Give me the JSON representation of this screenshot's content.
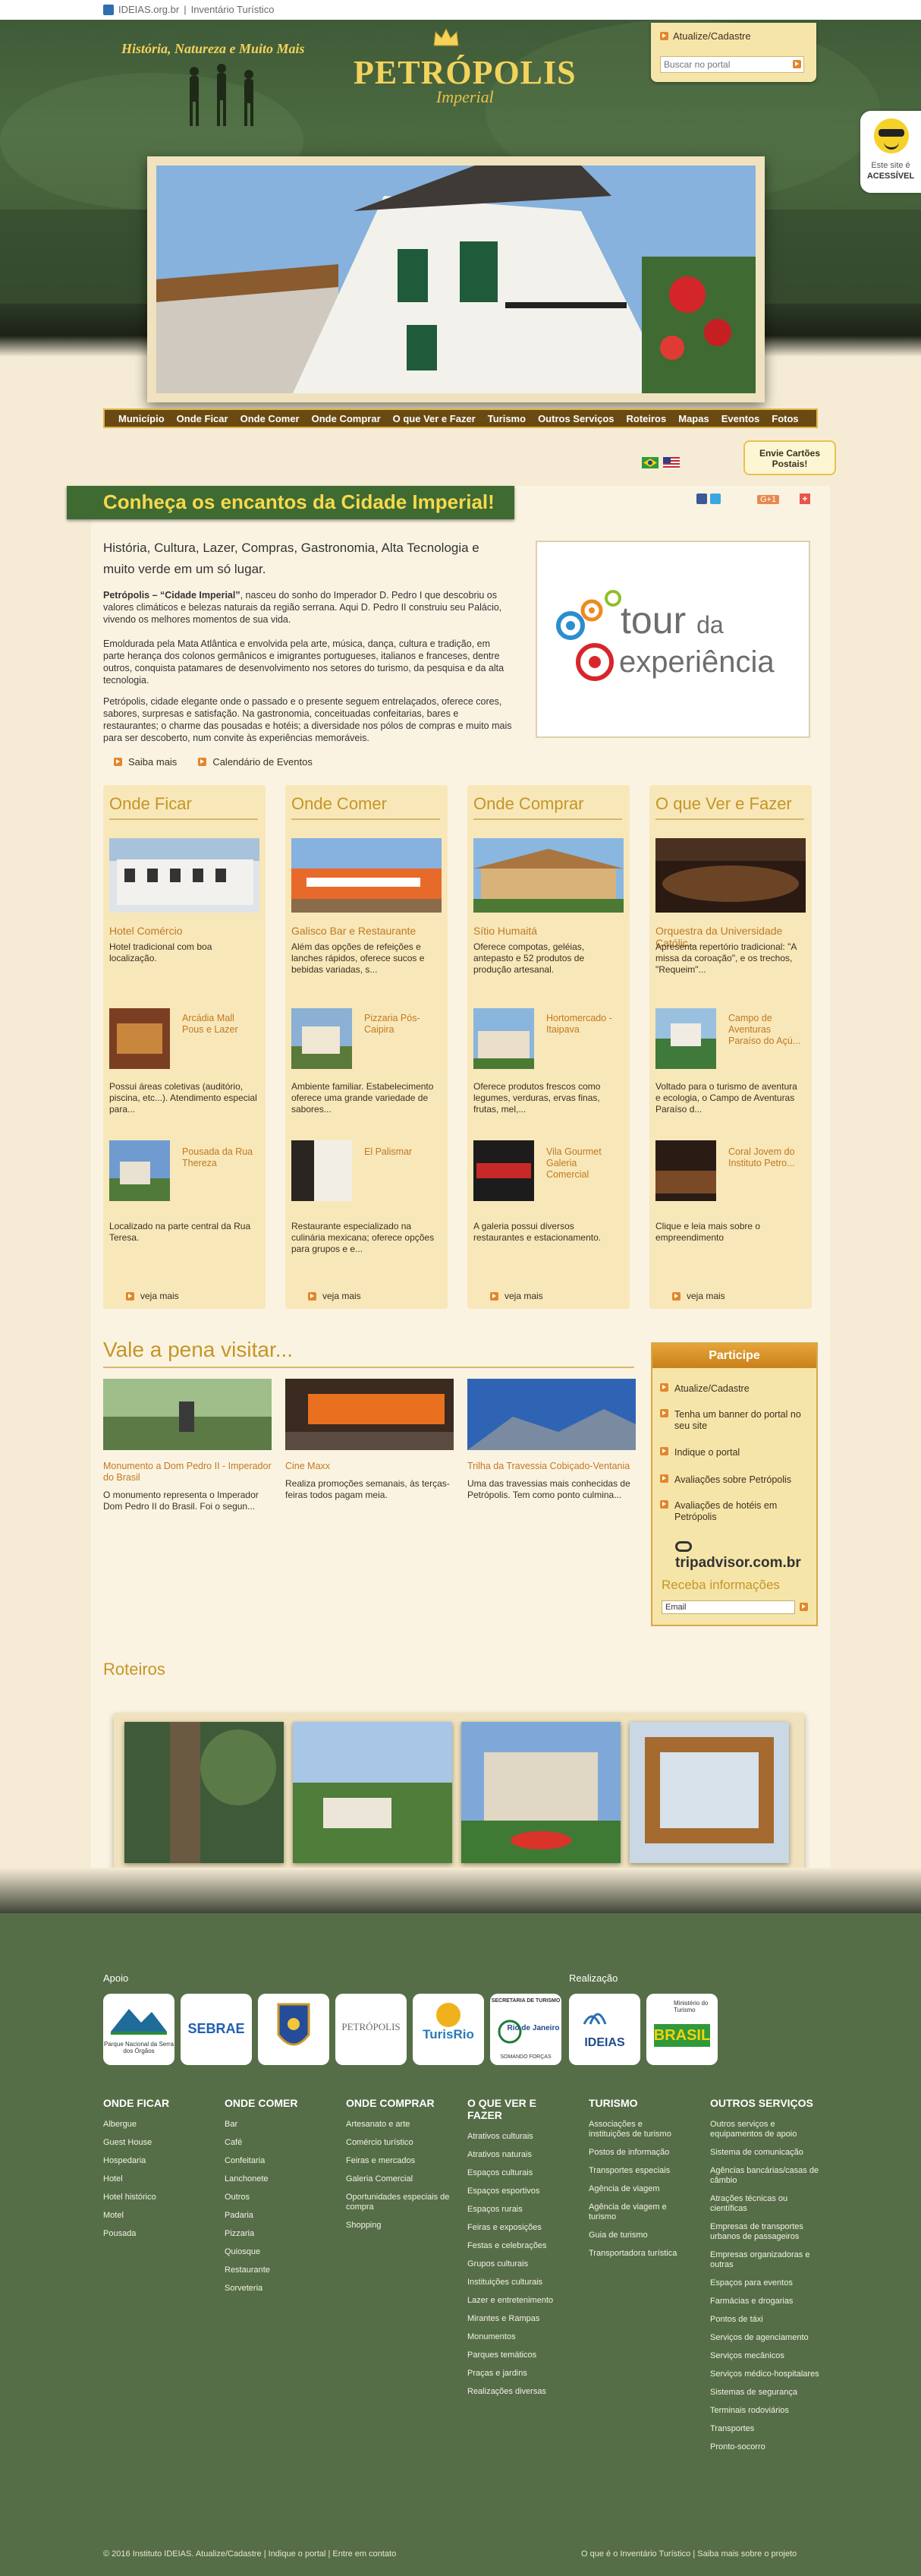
{
  "topbar": {
    "site_link": "IDEIAS.org.br",
    "separator": "|",
    "project": "Inventário Turístico"
  },
  "header": {
    "tagline": "História, Natureza e Muito Mais",
    "brand_name": "PETRÓPOLIS",
    "brand_sub": "Imperial",
    "login_link": "Atualize/Cadastre",
    "search_placeholder": "Buscar no portal"
  },
  "accessible": {
    "line1": "Este site é",
    "line2": "ACESSÍVEL"
  },
  "nav": [
    "Município",
    "Onde Ficar",
    "Onde Comer",
    "Onde Comprar",
    "O que Ver e Fazer",
    "Turismo",
    "Outros Serviços",
    "Roteiros",
    "Mapas",
    "Eventos",
    "Fotos"
  ],
  "cards_tip": {
    "line1": "Envie Cartões",
    "line2": "Postais!"
  },
  "intro": {
    "banner": "Conheça os encantos da Cidade Imperial!",
    "headline": "História, Cultura, Lazer, Compras, Gastronomia, Alta Tecnologia e muito verde em um só lugar.",
    "p1_bold": "Petrópolis – “Cidade Imperial”",
    "p1": ", nasceu do sonho do Imperador D. Pedro I que descobriu os valores climáticos e belezas naturais da região serrana. Aqui D. Pedro II construiu seu Palácio, vivendo os melhores momentos de sua vida.",
    "p2": "Emoldurada pela Mata Atlântica e envolvida pela arte, música, dança, cultura e tradição, em parte herança dos colonos germânicos e imigrantes portugueses, italianos e franceses, dentre outros, conquista patamares de desenvolvimento nos setores do turismo, da pesquisa e da alta tecnologia.",
    "p3": "Petrópolis, cidade elegante onde o passado e o presente seguem entrelaçados, oferece cores, sabores, surpresas e satisfação. Na gastronomia, conceituadas confeitarias, bares e restaurantes; o charme das pousadas e hotéis; a diversidade nos pólos de compras e muito mais para ser descoberto, num convite às experiências memoráveis.",
    "more": "Saiba mais",
    "events": "Calendário de Eventos",
    "tour_w1": "tour",
    "tour_w2": "da",
    "tour_w3": "experiência",
    "social_gplus": "G+1"
  },
  "columns": [
    {
      "title": "Onde Ficar",
      "main_title": "Hotel Comércio",
      "main_desc": "Hotel tradicional com boa localização.",
      "item1_title": "Arcádia Mall Pous e Lazer",
      "item1_desc": "Possui áreas coletivas (auditório, piscina, etc...). Atendimento especial para...",
      "item2_title": "Pousada da Rua Thereza",
      "item2_desc": "Localizado na parte central da Rua Teresa.",
      "more": "veja mais"
    },
    {
      "title": "Onde Comer",
      "main_title": "Galisco Bar e Restaurante",
      "main_desc": "Além das opções de refeições e lanches rápidos, oferece sucos e bebidas variadas, s...",
      "item1_title": "Pizzaria Pós-Caipira",
      "item1_desc": "Ambiente familiar. Estabelecimento oferece uma grande variedade de sabores...",
      "item2_title": "El Palismar",
      "item2_desc": "Restaurante especializado na culinária mexicana; oferece opções para grupos e e...",
      "more": "veja mais"
    },
    {
      "title": "Onde Comprar",
      "main_title": "Sítio Humaitá",
      "main_desc": "Oferece compotas, geléias, antepasto e 52 produtos de produção artesanal.",
      "item1_title": "Hortomercado - Itaipava",
      "item1_desc": "Oferece produtos frescos como legumes, verduras, ervas finas, frutas, mel,...",
      "item2_title": "Vila Gourmet Galeria Comercial",
      "item2_desc": "A galeria possui diversos restaurantes e estacionamento.",
      "more": "veja mais"
    },
    {
      "title": "O que Ver e Fazer",
      "main_title": "Orquestra da Universidade Católic...",
      "main_desc": "Apresenta repertório tradicional: \"A missa da coroação\", e os trechos, \"Requeim\"...",
      "item1_title": "Campo de Aventuras Paraíso do Açú...",
      "item1_desc": "Voltado para o turismo de aventura e ecologia, o Campo de Aventuras Paraíso d...",
      "item2_title": "Coral Jovem do Instituto Petro...",
      "item2_desc": "Clique e leia mais sobre o empreendimento",
      "more": "veja mais"
    }
  ],
  "vale": {
    "title": "Vale a pena visitar...",
    "items": [
      {
        "title": "Monumento a Dom Pedro II - Imperador do Brasil",
        "desc": "O monumento representa o Imperador Dom Pedro II do Brasil. Foi o segun..."
      },
      {
        "title": "Cine Maxx",
        "desc": "Realiza promoções semanais, às terças-feiras todos pagam meia."
      },
      {
        "title": "Trilha da Travessia Cobiçado-Ventania",
        "desc": "Uma das travessias mais conhecidas de Petrópolis. Tem como ponto culmina..."
      }
    ]
  },
  "participe": {
    "title": "Participe",
    "links": [
      "Atualize/Cadastre",
      "Tenha um banner do portal no seu site",
      "Indique o portal",
      "Avaliações sobre Petrópolis",
      "Avaliações de hotéis em Petrópolis"
    ],
    "tripadvisor": "tripadvisor.com.br",
    "newsletter": "Receba informações",
    "email_placeholder": "Email"
  },
  "roteiros": {
    "title": "Roteiros"
  },
  "footer": {
    "apoio": "Apoio",
    "realizacao": "Realização",
    "logos": {
      "pnst": "Parque Nacional da Serra dos Órgãos",
      "sebrae": "SEBRAE",
      "petropolis": "PETRÓPOLIS",
      "turisrio": "TurisRio",
      "secretaria": "SECRETARIA DE TURISMO",
      "rio": "Rio de Janeiro",
      "rio_sub": "SOMANDO FORÇAS",
      "ideias": "IDEIAS",
      "ministerio": "Ministério do Turismo",
      "brasil": "BRASIL"
    },
    "cols": [
      {
        "title": "ONDE FICAR",
        "items": [
          "Albergue",
          "Guest House",
          "Hospedaria",
          "Hotel",
          "Hotel histórico",
          "Motel",
          "Pousada"
        ]
      },
      {
        "title": "ONDE COMER",
        "items": [
          "Bar",
          "Café",
          "Confeitaria",
          "Lanchonete",
          "Outros",
          "Padaria",
          "Pizzaria",
          "Quiosque",
          "Restaurante",
          "Sorveteria"
        ]
      },
      {
        "title": "ONDE COMPRAR",
        "items": [
          "Artesanato e arte",
          "Comércio turístico",
          "Feiras e mercados",
          "Galeria Comercial",
          "Oportunidades especiais de compra",
          "Shopping"
        ]
      },
      {
        "title": "O QUE VER E FAZER",
        "items": [
          "Atrativos culturais",
          "Atrativos naturais",
          "Espaços culturais",
          "Espaços esportivos",
          "Espaços rurais",
          "Feiras e exposições",
          "Festas e celebrações",
          "Grupos culturais",
          "Instituições culturais",
          "Lazer e entretenimento",
          "Mirantes e Rampas",
          "Monumentos",
          "Parques temáticos",
          "Praças e jardins",
          "Realizações diversas"
        ]
      },
      {
        "title": "TURISMO",
        "items": [
          "Associações e instituições de turismo",
          "Postos de informação",
          "Transportes especiais",
          "Agência de viagem",
          "Agência de viagem e turismo",
          "Guia de turismo",
          "Transportadora turística"
        ]
      },
      {
        "title": "OUTROS SERVIÇOS",
        "items": [
          "Outros serviços e equipamentos de apoio",
          "Sistema de comunicação",
          "Agências bancárias/casas de câmbio",
          "Atrações técnicas ou científicas",
          "Empresas de transportes urbanos de passageiros",
          "Empresas organizadoras e outras",
          "Espaços para eventos",
          "Farmácias e drogarias",
          "Pontos de táxi",
          "Serviços de agenciamento",
          "Serviços mecânicos",
          "Serviços médico-hospitalares",
          "Sistemas de segurança",
          "Terminais rodoviários",
          "Transportes",
          "Pronto-socorro"
        ]
      }
    ],
    "bottom_left": "© 2016 Instituto IDEIAS. Atualize/Cadastre | Indique o portal | Entre em contato",
    "bottom_right": "O que é o Inventário Turístico | Saiba mais sobre o projeto"
  }
}
